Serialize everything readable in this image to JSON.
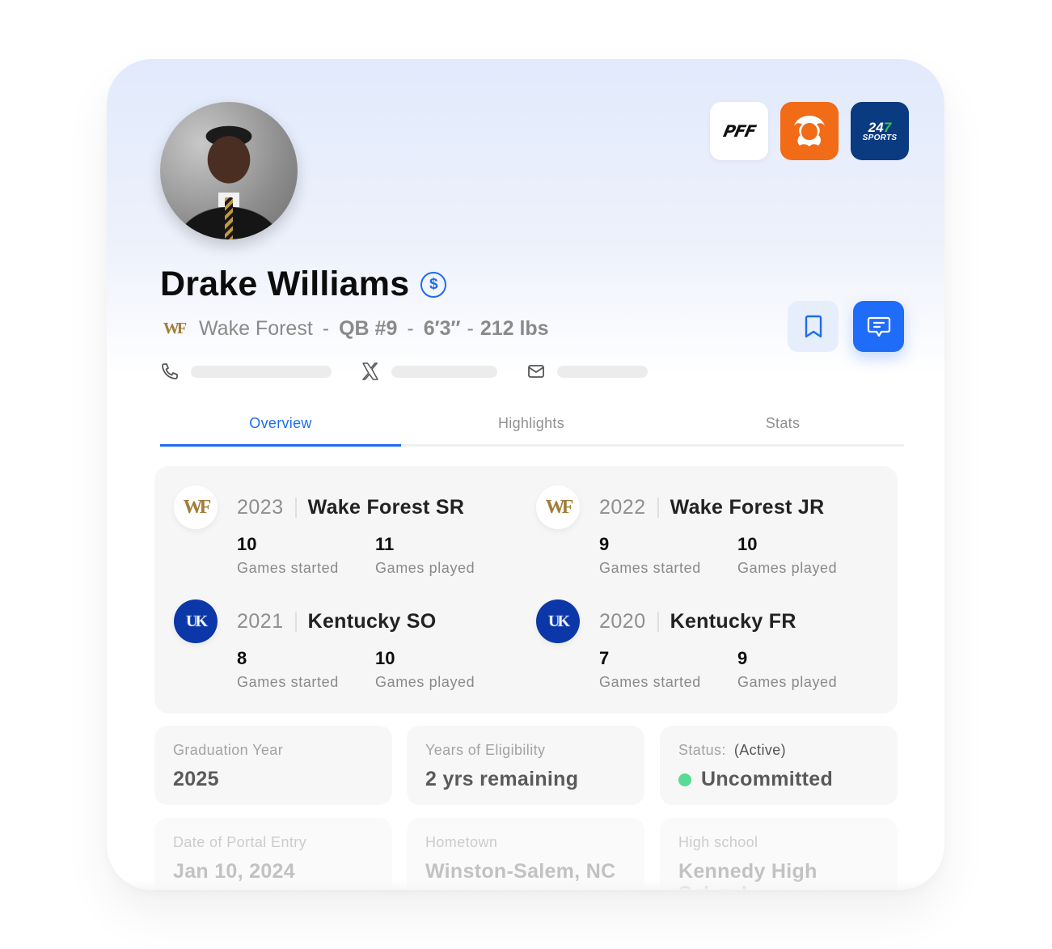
{
  "player": {
    "name": "Drake Williams",
    "nil_icon": "dollar-circle-icon",
    "school": "Wake Forest",
    "school_logo_text": "WF",
    "position": "QB #9",
    "height": "6′3″",
    "weight": "212 lbs",
    "separator": "-"
  },
  "sources": [
    {
      "name": "PFF",
      "label": "PFF",
      "color": "#ffffff"
    },
    {
      "name": "On3",
      "label": "",
      "color": "#f26b16"
    },
    {
      "name": "247Sports",
      "label_top": "247",
      "label_bottom": "SPORTS",
      "color": "#0a3a80"
    }
  ],
  "contact": {
    "phone_icon": "phone-icon",
    "x_icon": "x-twitter-icon",
    "email_icon": "mail-icon"
  },
  "actions": {
    "bookmark": "bookmark-icon",
    "message": "message-icon"
  },
  "tabs": [
    {
      "label": "Overview",
      "active": true
    },
    {
      "label": "Highlights",
      "active": false
    },
    {
      "label": "Stats",
      "active": false
    }
  ],
  "seasons": [
    {
      "year": "2023",
      "team": "Wake Forest SR",
      "logo": "WF",
      "started": "10",
      "played": "11",
      "started_label": "Games started",
      "played_label": "Games played"
    },
    {
      "year": "2022",
      "team": "Wake Forest JR",
      "logo": "WF",
      "started": "9",
      "played": "10",
      "started_label": "Games started",
      "played_label": "Games played"
    },
    {
      "year": "2021",
      "team": "Kentucky SO",
      "logo": "UK",
      "started": "8",
      "played": "10",
      "started_label": "Games started",
      "played_label": "Games played"
    },
    {
      "year": "2020",
      "team": "Kentucky FR",
      "logo": "UK",
      "started": "7",
      "played": "9",
      "started_label": "Games started",
      "played_label": "Games played"
    }
  ],
  "details": [
    {
      "label": "Graduation Year",
      "value": "2025"
    },
    {
      "label": "Years of Eligibility",
      "value": "2 yrs remaining"
    },
    {
      "label": "Status:",
      "note": "(Active)",
      "value": "Uncommitted",
      "status_color": "#56dc95"
    },
    {
      "label": "Date of Portal Entry",
      "value": "Jan 10, 2024"
    },
    {
      "label": "Hometown",
      "value": "Winston-Salem, NC"
    },
    {
      "label": "High school",
      "value": "Kennedy High School"
    }
  ]
}
